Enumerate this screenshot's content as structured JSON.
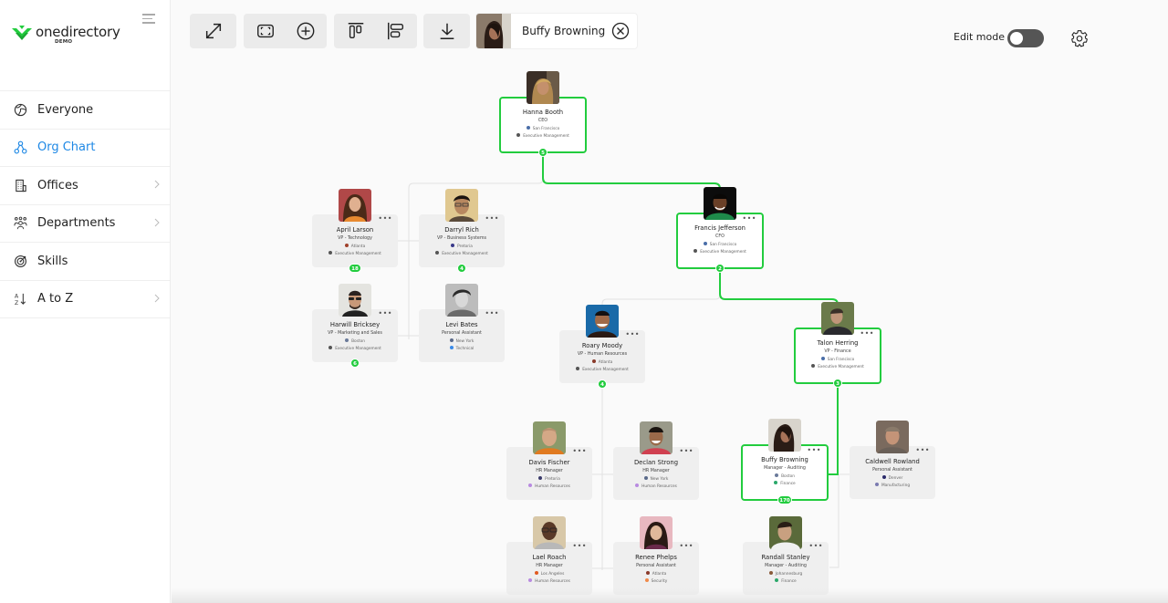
{
  "app": {
    "logo_name": "onedirectory",
    "logo_tag": "DEMO",
    "brand_color": "#22cc3e",
    "accent_color": "#1e88e5"
  },
  "sidebar": {
    "items": [
      {
        "label": "Everyone",
        "icon": "globe-icon",
        "active": false,
        "chevron": false
      },
      {
        "label": "Org Chart",
        "icon": "org-chart-icon",
        "active": true,
        "chevron": false
      },
      {
        "label": "Offices",
        "icon": "building-icon",
        "active": false,
        "chevron": true
      },
      {
        "label": "Departments",
        "icon": "people-group-icon",
        "active": false,
        "chevron": true
      },
      {
        "label": "Skills",
        "icon": "target-icon",
        "active": false,
        "chevron": false
      },
      {
        "label": "A to Z",
        "icon": "sort-az-icon",
        "active": false,
        "chevron": true
      }
    ]
  },
  "toolbar": {
    "expand_icon": "expand-icon",
    "fit_icon": "fit-screen-icon",
    "zoom_in_icon": "zoom-in-icon",
    "align_top_icon": "align-top-icon",
    "align_left_icon": "align-left-icon",
    "download_icon": "download-icon",
    "selected_person": "Buffy Browning",
    "edit_mode_label": "Edit mode",
    "edit_mode_on": false
  },
  "org": {
    "hanna": {
      "name": "Hanna Booth",
      "title": "CEO",
      "office": "San Francisco",
      "department": "Executive Management",
      "reports": "5"
    },
    "april": {
      "name": "April Larson",
      "title": "VP - Technology",
      "office": "Atlanta",
      "department": "Executive Management",
      "reports": "18"
    },
    "darryl": {
      "name": "Darryl Rich",
      "title": "VP - Business Systems",
      "office": "Pretoria",
      "department": "Executive Management",
      "reports": "4"
    },
    "harwill": {
      "name": "Harwill Bricksey",
      "title": "VP - Marketing and Sales",
      "office": "Boston",
      "department": "Executive Management",
      "reports": "6"
    },
    "levi": {
      "name": "Levi Bates",
      "title": "Personal Assistant",
      "office": "New York",
      "department": "Technical"
    },
    "francis": {
      "name": "Francis Jefferson",
      "title": "CFO",
      "office": "San Francisco",
      "department": "Executive Management",
      "reports": "2"
    },
    "roary": {
      "name": "Roary Moody",
      "title": "VP - Human Resources",
      "office": "Atlanta",
      "department": "Executive Management",
      "reports": "4"
    },
    "talon": {
      "name": "Talon Herring",
      "title": "VP - Finance",
      "office": "San Francisco",
      "department": "Executive Management",
      "reports": "3"
    },
    "davis": {
      "name": "Davis Fischer",
      "title": "HR Manager",
      "office": "Pretoria",
      "department": "Human Resources"
    },
    "declan": {
      "name": "Declan Strong",
      "title": "HR Manager",
      "office": "New York",
      "department": "Human Resources"
    },
    "lael": {
      "name": "Lael Roach",
      "title": "HR Manager",
      "office": "Los Angeles",
      "department": "Human Resources"
    },
    "renee": {
      "name": "Renee Phelps",
      "title": "Personal Assistant",
      "office": "Atlanta",
      "department": "Security"
    },
    "buffy": {
      "name": "Buffy Browning",
      "title": "Manager - Auditing",
      "office": "Boston",
      "department": "Finance",
      "reports": "170"
    },
    "caldwell": {
      "name": "Caldwell Rowland",
      "title": "Personal Assistant",
      "office": "Denver",
      "department": "Manufacturing"
    },
    "randall": {
      "name": "Randall Stanley",
      "title": "Manager - Auditing",
      "office": "Johannesburg",
      "department": "Finance"
    }
  },
  "more_label": "•••"
}
